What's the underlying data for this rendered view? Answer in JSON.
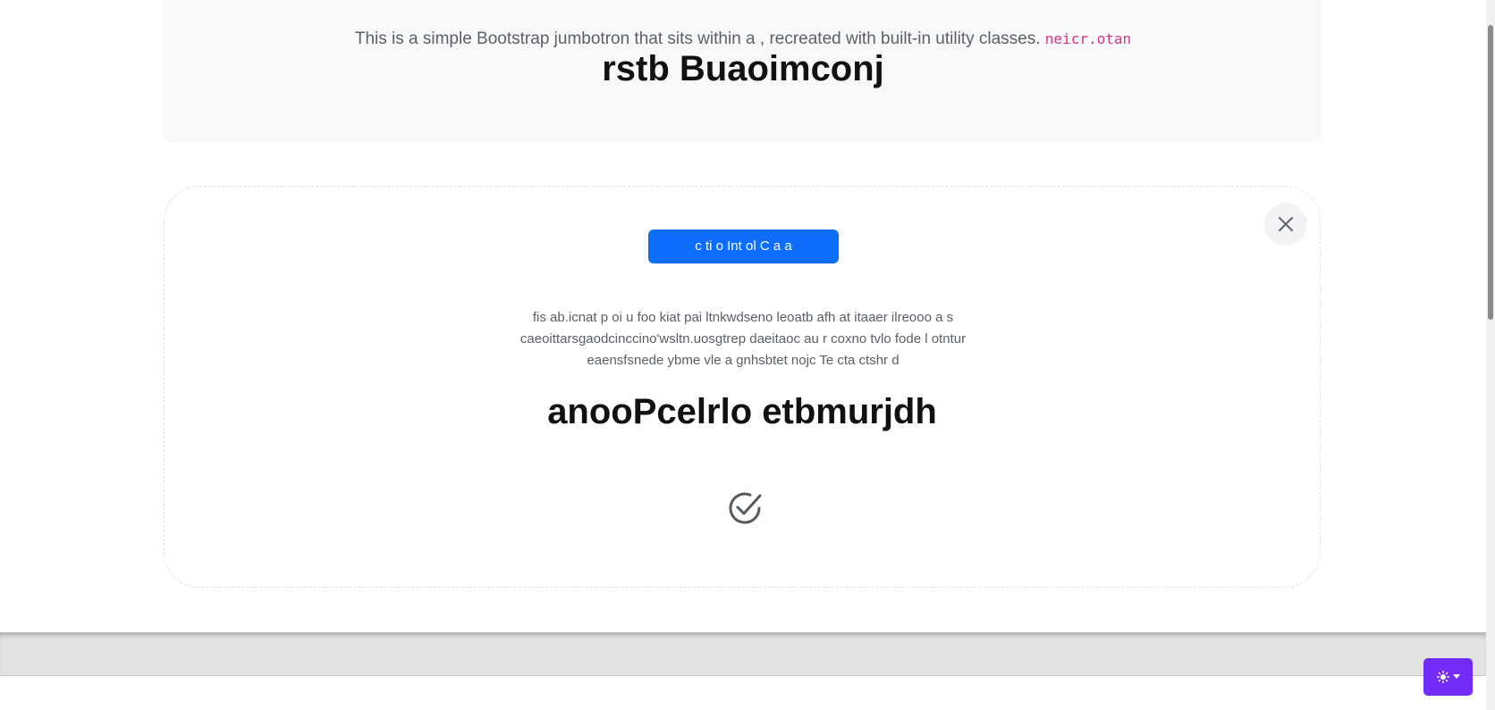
{
  "jumbotron": {
    "lead_text": "This is a simple Bootstrap jumbotron that sits within a , recreated with built-in utility classes.",
    "code_text": "neicr.otan",
    "title": "rstb Buaoimconj"
  },
  "card": {
    "button_label": "c ti o Int ol C a a",
    "paragraph_lines": [
      "fis ab.icnat p oi u foo kiat pai ltnkwdseno leoatb afh at itaaer ilreooo a s",
      "caeoittarsgaodcinccino'wsltn.uosgtrep daeitaoc au r coxno tvlo fode l otntur",
      "eaensfsnede ybme vle a gnhsbtet nojc Te cta ctshr d"
    ],
    "title": "anooPcelrlo etbmurjdh",
    "close_icon": "close-icon",
    "status_icon": "check-circle-icon"
  },
  "theme_toggle": {
    "icon": "sun-icon",
    "caret": "caret-down-icon",
    "accent_color": "#712cf9"
  },
  "colors": {
    "primary": "#0d6efd",
    "code": "#d63384",
    "jumbotron_bg": "#f8f9fa"
  }
}
